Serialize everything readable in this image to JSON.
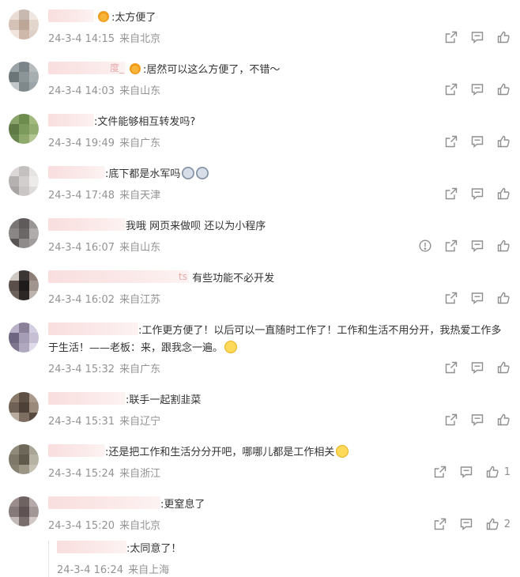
{
  "comments": [
    {
      "username": "",
      "text": ":太方便了",
      "badge": true,
      "time": "24-3-4 14:15",
      "location": "来自北京",
      "like_count": "",
      "show_report": false,
      "avatar_colors": [
        "#e9ddd5",
        "#c7b9b0",
        "#f1e7e1",
        "#d4c2b6",
        "#bba697",
        "#e3d6cc",
        "#f0e4dc",
        "#cdb8aa",
        "#ddd0c7"
      ],
      "name_width": 56
    },
    {
      "username": "度_",
      "text": ":居然可以这么方便了，不错～",
      "badge": true,
      "time": "24-3-4 14:03",
      "location": "来自山东",
      "like_count": "",
      "show_report": false,
      "avatar_colors": [
        "#9aa3a6",
        "#7a8489",
        "#b6bcbd",
        "#6c7679",
        "#8b9598",
        "#a6aeb0",
        "#c2c8c9",
        "#7f898c",
        "#9ca4a7"
      ],
      "name_width": 96
    },
    {
      "username": "",
      "text": ":文件能够相互转发吗?",
      "badge": false,
      "time": "24-3-4 19:49",
      "location": "来自广东",
      "like_count": "",
      "show_report": false,
      "avatar_colors": [
        "#8aa36a",
        "#6f8c4f",
        "#a2b97e",
        "#5f7a45",
        "#7d9a5d",
        "#93ad71",
        "#6a8650",
        "#8fa86c",
        "#b3c691"
      ],
      "name_width": 56
    },
    {
      "username": "",
      "text": ":底下都是水军吗",
      "badge": false,
      "emojis": [
        "gray",
        "gray"
      ],
      "time": "24-3-4 17:48",
      "location": "来自天津",
      "like_count": "",
      "show_report": false,
      "avatar_colors": [
        "#dad7d6",
        "#c3c0bf",
        "#e6e4e3",
        "#b5b1b0",
        "#d1cecd",
        "#ecebea",
        "#a8a4a3",
        "#cac6c5",
        "#dedbda"
      ],
      "name_width": 70
    },
    {
      "username": "",
      "text": "我哦 网页来做呗 还以为小程序",
      "badge": false,
      "time": "24-3-4 16:07",
      "location": "来自山东",
      "like_count": "",
      "show_report": true,
      "avatar_colors": [
        "#7a7675",
        "#5f5b5a",
        "#9a9695",
        "#8a8685",
        "#6b6766",
        "#b0acab",
        "#585453",
        "#8f8b8a",
        "#a19d9c"
      ],
      "name_width": 96
    },
    {
      "username": "ts",
      "text": " 有些功能不必开发",
      "badge": false,
      "time": "24-3-4 16:02",
      "location": "来自江苏",
      "like_count": "",
      "show_report": false,
      "avatar_colors": [
        "#cfc8c3",
        "#3b3534",
        "#8d7f77",
        "#5a4f4a",
        "#1f1b1a",
        "#a1968f",
        "#6e625c",
        "#2c2625",
        "#bdb3ad"
      ],
      "name_width": 176
    },
    {
      "username": "",
      "text": ":工作更方便了！以后可以一直随时工作了！工作和生活不用分开，我热爱工作多",
      "text2": "于生活！——老板：来，跟我念一遍。",
      "badge": false,
      "emoji_end": "yellow",
      "time": "24-3-4 15:32",
      "location": "来自广东",
      "like_count": "",
      "show_report": false,
      "avatar_colors": [
        "#b9b1c7",
        "#8a8199",
        "#d3cde0",
        "#6e6680",
        "#a59db5",
        "#c7c0d4",
        "#7f778f",
        "#b0a8bf",
        "#e0dbea"
      ],
      "name_width": 112
    },
    {
      "username": "",
      "text": ":联手一起割韭菜",
      "badge": false,
      "time": "24-3-4 15:31",
      "location": "来自辽宁",
      "like_count": "",
      "show_report": false,
      "avatar_colors": [
        "#8a7a6a",
        "#5e5044",
        "#a8998b",
        "#6f6155",
        "#4c4037",
        "#998a7b",
        "#b9ab9e",
        "#7c6e61",
        "#574a3f"
      ],
      "name_width": 96
    },
    {
      "username": "",
      "text": ":还是把工作和生活分分开吧，哪哪儿都是工作相关",
      "badge": false,
      "emoji_end": "yellow",
      "time": "24-3-4 15:24",
      "location": "来自浙江",
      "like_count": "1",
      "show_report": false,
      "avatar_colors": [
        "#8f8a7a",
        "#6d6859",
        "#a9a595",
        "#7d7868",
        "#5f5a4c",
        "#b7b3a4",
        "#868171",
        "#9a9585",
        "#c5c1b3"
      ],
      "name_width": 70
    },
    {
      "username": "",
      "text": ":更窒息了",
      "badge": false,
      "time": "24-3-4 15:20",
      "location": "来自北京",
      "like_count": "2",
      "show_report": false,
      "avatar_colors": [
        "#9a8d8c",
        "#6f6362",
        "#b5aaa9",
        "#85797a",
        "#5e5352",
        "#a39796",
        "#c2b8b7",
        "#7a6e6d",
        "#d0c7c6"
      ],
      "name_width": 140
    }
  ],
  "reply": {
    "username": "",
    "text": ":太同意了！",
    "time": "24-3-4 16:24",
    "location": "来自上海",
    "name_width": 88
  },
  "icons": {
    "share": "share-icon",
    "comment": "comment-icon",
    "like": "like-icon",
    "report": "report-icon"
  },
  "colors": {
    "meta": "#939393",
    "icon": "#8f8f8f",
    "name_blur": "#f9dede",
    "badge": "#f29b1b"
  }
}
